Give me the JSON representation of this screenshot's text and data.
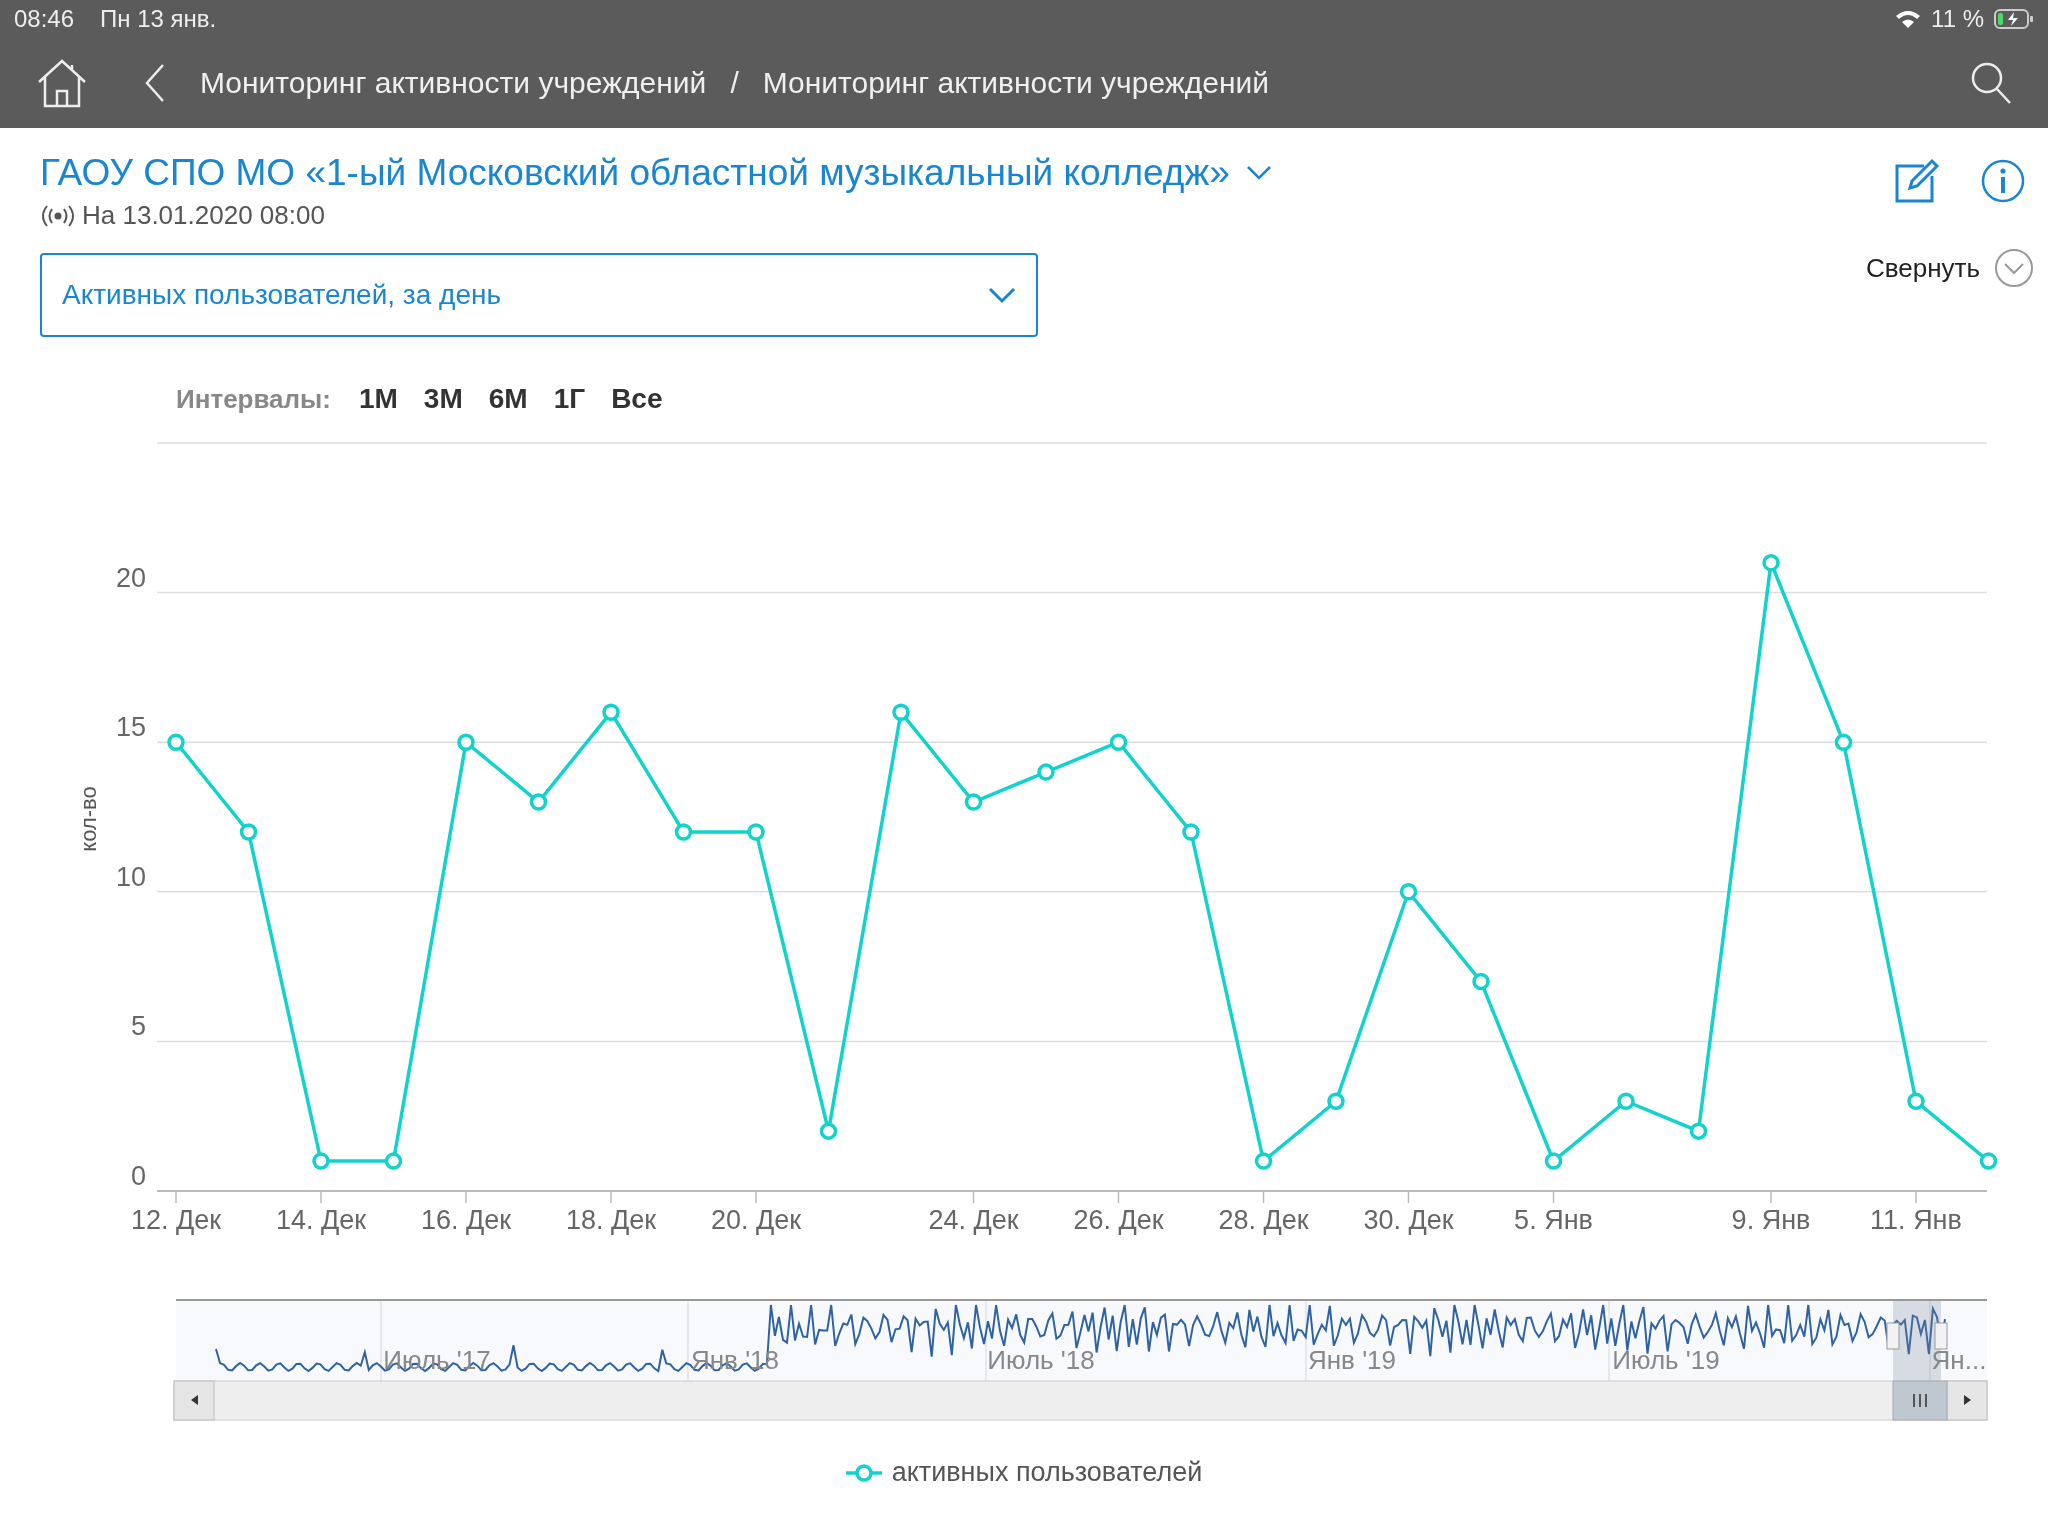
{
  "status_bar": {
    "time": "08:46",
    "date": "Пн 13 янв.",
    "battery": "11 %"
  },
  "nav_bar": {
    "breadcrumbs": [
      "Мониторинг активности учреждений",
      "Мониторинг активности учреждений"
    ],
    "separator": "/"
  },
  "header": {
    "title": "ГАОУ СПО МО «1-ый Московский областной музыкальный колледж»",
    "updated": "На 13.01.2020 08:00",
    "collapse": "Свернуть"
  },
  "metric_select": {
    "value": "Активных пользователей, за день"
  },
  "intervals": {
    "label": "Интервалы:",
    "options": [
      {
        "label": "1М",
        "selected": false
      },
      {
        "label": "3М",
        "selected": false
      },
      {
        "label": "6М",
        "selected": false
      },
      {
        "label": "1Г",
        "selected": false
      },
      {
        "label": "Все",
        "selected": false
      }
    ]
  },
  "chart": {
    "chart_data": {
      "type": "line",
      "ylabel": "кол-во",
      "categories": [
        "12. Дек",
        null,
        "14. Дек",
        null,
        "16. Дек",
        null,
        "18. Дек",
        null,
        "20. Дек",
        null,
        null,
        "24. Дек",
        null,
        "26. Дек",
        null,
        "28. Дек",
        null,
        "30. Дек",
        null,
        "5. Янв",
        null,
        null,
        "9. Янв",
        null,
        "11. Янв",
        null
      ],
      "series": [
        {
          "name": "активных пользователей",
          "color": "#12d3cc",
          "marker": "circle",
          "values": [
            15,
            12,
            1,
            1,
            15,
            13,
            16,
            12,
            12,
            2,
            16,
            13,
            14,
            15,
            12,
            1,
            3,
            10,
            7,
            1,
            3,
            2,
            21,
            15,
            3,
            1
          ]
        }
      ],
      "ylim": [
        0,
        25
      ],
      "yticks": [
        0,
        5,
        10,
        15,
        20
      ],
      "grid": true
    }
  },
  "navigator": {
    "labels": [
      "Июль '17",
      "Янв '18",
      "Июль '18",
      "Янв '19",
      "Июль '19",
      "Ян..."
    ]
  }
}
